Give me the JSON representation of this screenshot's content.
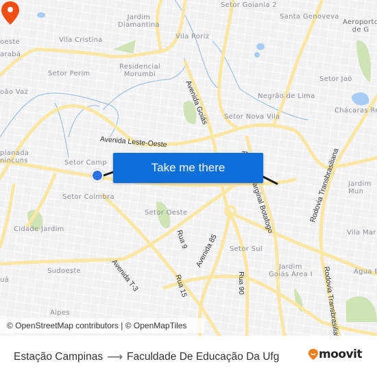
{
  "map": {
    "neighborhoods": [
      {
        "name": "Jardim\nDiamantina"
      },
      {
        "name": "Vila Cristina"
      },
      {
        "name": "Setor Perim"
      },
      {
        "name": "Residencial\nMorumbi"
      },
      {
        "name": "Vila Roriz"
      },
      {
        "name": "Setor Goiania 2"
      },
      {
        "name": "Santa Genoveva"
      },
      {
        "name": "Aeroporto\nde G"
      },
      {
        "name": "Setor Jaó"
      },
      {
        "name": "Negrão de Lima"
      },
      {
        "name": "Chácaras Re"
      },
      {
        "name": "Setor Nova Vila"
      },
      {
        "name": "oeste"
      },
      {
        "name": "arabá"
      },
      {
        "name": "oão Vaz"
      },
      {
        "name": "planada\nnincuns"
      },
      {
        "name": "Setor Campinas"
      },
      {
        "name": "Setor Coimbra"
      },
      {
        "name": "Cidade Jardim"
      },
      {
        "name": "Setor Oeste"
      },
      {
        "name": "Sudoeste"
      },
      {
        "name": "uá"
      },
      {
        "name": "Alpes"
      },
      {
        "name": "Setor Sul"
      },
      {
        "name": "Jardim\nGoiás Área I"
      },
      {
        "name": "Jardim\nMun"
      },
      {
        "name": "Vila Mar"
      },
      {
        "name": "Água B"
      }
    ],
    "roads": [
      {
        "name": "Avenida Leste-Oeste"
      },
      {
        "name": "Avenida Goiás"
      },
      {
        "name": "Avenida Marginal Botafogo"
      },
      {
        "name": "Rodovia Transbrasiliana"
      },
      {
        "name": "Rodovia Transbrasiliana"
      },
      {
        "name": "Rua 9"
      },
      {
        "name": "Rua 15"
      },
      {
        "name": "Avenida 85"
      },
      {
        "name": "Rua 90"
      },
      {
        "name": "Avenida T-3"
      }
    ],
    "attribution": "© OpenStreetMap contributors | © OpenMapTiles",
    "cta_label": "Take me there",
    "colors": {
      "background": "#f2f2f3",
      "major_road": "#fbe7a5",
      "minor_road": "#ffffff",
      "park": "#cfe3b5",
      "water": "#a9cdf2",
      "route_line": "#1e1e1e",
      "origin_marker": "#2f6fe6",
      "destination_marker": "#f04e14",
      "cta_background": "#0a6fd8"
    }
  },
  "footer": {
    "origin": "Estação Campinas",
    "arrow": "⟶",
    "destination": "Faculdade De Educação Da Ufg",
    "brand": "moovit",
    "brand_color": "#f07c1a"
  }
}
